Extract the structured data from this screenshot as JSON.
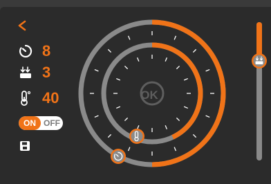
{
  "nav": {
    "back_label": "<"
  },
  "stats": [
    {
      "icon": "timer-icon",
      "value": "8"
    },
    {
      "icon": "tool-level-icon",
      "value": "3"
    },
    {
      "icon": "thermometer-icon",
      "value": "40"
    }
  ],
  "toggle": {
    "on_label": "ON",
    "off_label": "OFF",
    "state": "on"
  },
  "dial": {
    "center_label": "OK",
    "outer_ring_fraction": 0.5,
    "inner_ring_fraction": 0.43,
    "accent_color": "#f07318",
    "track_color": "#8a8a8a"
  },
  "slider": {
    "icon": "tool-level-icon",
    "level_fraction": 0.72
  },
  "colors": {
    "accent": "#f07318",
    "background": "#2b2b2b",
    "text": "#ffffff"
  }
}
